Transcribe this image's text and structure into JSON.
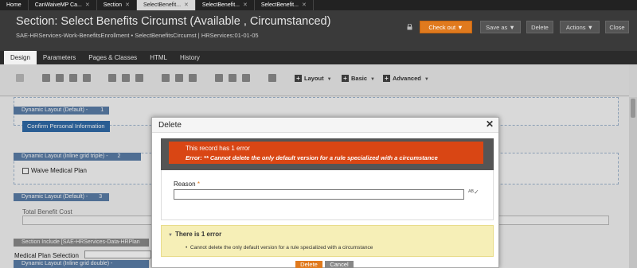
{
  "top_tabs": [
    {
      "label": "Home",
      "closable": false,
      "active": false
    },
    {
      "label": "CanWaiveMP Ca...",
      "closable": true,
      "active": false
    },
    {
      "label": "Section",
      "closable": true,
      "active": false
    },
    {
      "label": "SelectBenefit...",
      "closable": true,
      "active": true
    },
    {
      "label": "SelectBenefit...",
      "closable": true,
      "active": false
    },
    {
      "label": "SelectBenefit...",
      "closable": true,
      "active": false
    }
  ],
  "header": {
    "title": "Section: Select Benefits Circumst (Available , Circumstanced)",
    "subtitle": "SAE-HRServices-Work-BenefitsEnrollment • SelectBenefitsCircumst  |  HRServices:01-01-05",
    "buttons": {
      "checkout": "Check out",
      "saveas": "Save as",
      "delete": "Delete",
      "actions": "Actions",
      "close": "Close"
    },
    "accent": "#e07a1e"
  },
  "design_tabs": [
    "Design",
    "Parameters",
    "Pages & Classes",
    "HTML",
    "History"
  ],
  "toolbar": {
    "groups": [
      "Layout",
      "Basic",
      "Advanced"
    ]
  },
  "canvas": {
    "layout1": "Dynamic Layout (Default) -",
    "layout1_num": "1",
    "confirm_button": "Confirm Personal Information",
    "layout2": "Dynamic Layout (Inline grid triple) -",
    "layout2_num": "2",
    "waive_label": "Waive Medical Plan",
    "layout3": "Dynamic Layout (Default) -",
    "layout3_num": "3",
    "total_label": "Total Benefit Cost",
    "section_include": "Section Include [SAE-HRServices-Data-HRPlan",
    "medical_label": "Medical Plan Selection",
    "layout4": "Dynamic Layout (Inline grid double) -"
  },
  "modal": {
    "title": "Delete",
    "close_glyph": "✕",
    "error_title": "This record has 1 error",
    "error_message": "Error: ** Cannot delete the only default version for a rule specialized with a circumstance",
    "reason_label": "Reason",
    "reason_required": "*",
    "reason_value": "",
    "error_list_title": "There is 1 error",
    "error_list_item": "Cannot delete the only default version for a rule specialized with a circumstance",
    "delete_button": "Delete",
    "cancel_button": "Cancel",
    "error_color": "#d94614"
  }
}
